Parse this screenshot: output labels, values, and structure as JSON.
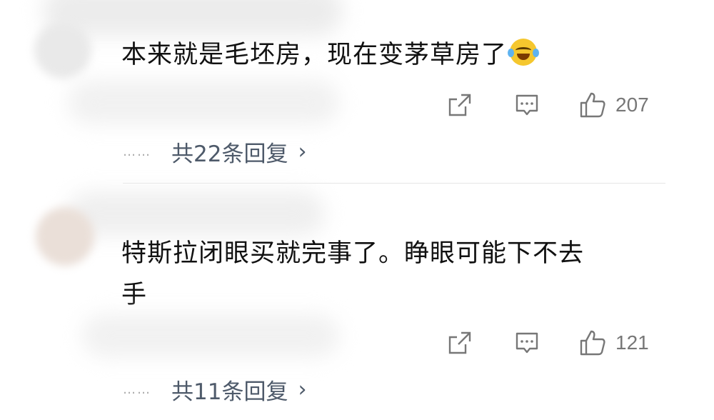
{
  "comments": [
    {
      "text": "本来就是毛坯房，现在变茅草房了",
      "emoji": "laughing-crying-emoji",
      "likes": "207",
      "replies_label": "共22条回复",
      "dots": "……"
    },
    {
      "text": "特斯拉闭眼买就完事了。睁眼可能下不去手",
      "line1": "特斯拉闭眼买就完事了。睁眼可能下不去",
      "line2": "手",
      "likes": "121",
      "replies_label": "共11条回复",
      "dots": "……"
    }
  ],
  "icons": {
    "share": "share-icon",
    "comment": "comment-icon",
    "like": "thumbs-up-icon",
    "chevron": "›"
  },
  "colors": {
    "action_gray": "#777777",
    "reply_link": "#4e5a6a"
  }
}
